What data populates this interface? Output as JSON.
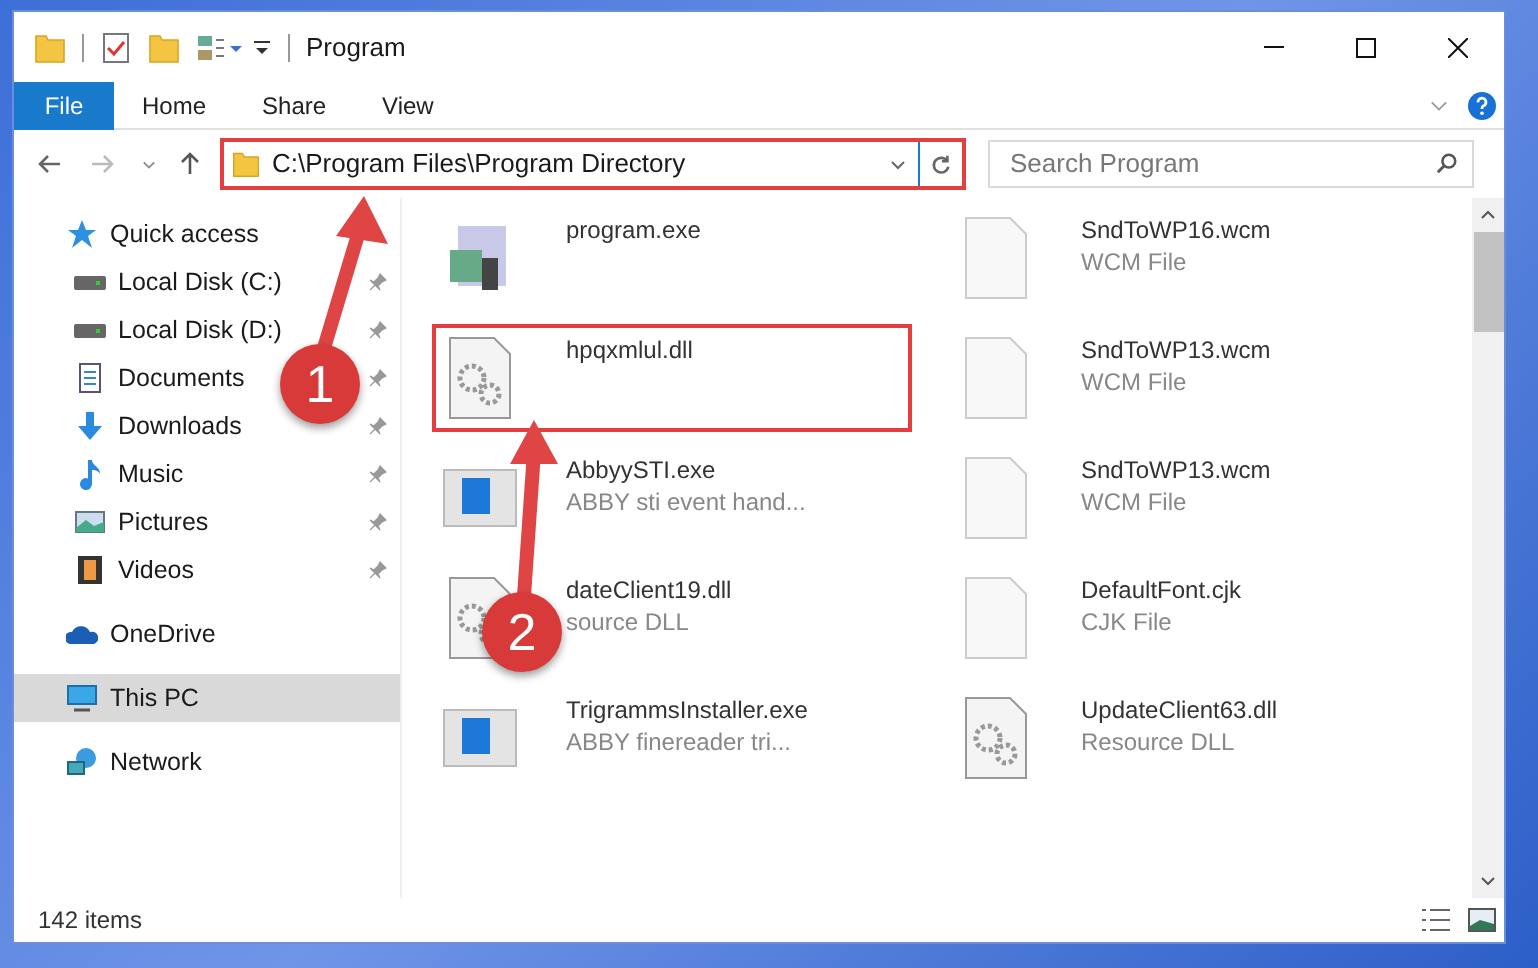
{
  "window": {
    "title": "Program"
  },
  "ribbon_tabs": [
    {
      "label": "File",
      "kind": "file",
      "selected": false
    },
    {
      "label": "Home",
      "kind": "tab",
      "selected": false
    },
    {
      "label": "Share",
      "kind": "tab",
      "selected": false
    },
    {
      "label": "View",
      "kind": "tab",
      "selected": false
    }
  ],
  "address_bar": {
    "path": "C:\\Program Files\\Program Directory",
    "highlighted": true
  },
  "search": {
    "placeholder": "Search Program"
  },
  "navigation": [
    {
      "label": "Quick access",
      "kind": "star",
      "selected": false,
      "children": [
        {
          "label": "Local Disk (C:)",
          "kind": "drive",
          "pinned": true
        },
        {
          "label": "Local Disk (D:)",
          "kind": "drive",
          "pinned": true
        },
        {
          "label": "Documents",
          "kind": "documents",
          "pinned": true
        },
        {
          "label": "Downloads",
          "kind": "downloads",
          "pinned": true
        },
        {
          "label": "Music",
          "kind": "music",
          "pinned": true
        },
        {
          "label": "Pictures",
          "kind": "pictures",
          "pinned": true
        },
        {
          "label": "Videos",
          "kind": "videos",
          "pinned": true
        }
      ]
    },
    {
      "label": "OneDrive",
      "kind": "cloud",
      "selected": false
    },
    {
      "label": "This PC",
      "kind": "pc",
      "selected": true
    },
    {
      "label": "Network",
      "kind": "network",
      "selected": false
    }
  ],
  "files": [
    {
      "name": "program.exe",
      "kind": "exe",
      "highlighted": false
    },
    {
      "name": "SndToWP16.wcm",
      "description": "WCM File",
      "kind": "blank",
      "highlighted": false
    },
    {
      "name": "hpqxmlul.dll",
      "kind": "dll",
      "highlighted": true
    },
    {
      "name": "SndToWP13.wcm",
      "description": "WCM File",
      "kind": "blank",
      "highlighted": false
    },
    {
      "name": "AbbyySTI.exe",
      "description": "ABBY sti event hand...",
      "kind": "app",
      "highlighted": false
    },
    {
      "name": "SndToWP13.wcm",
      "description": "WCM File",
      "kind": "blank",
      "highlighted": false
    },
    {
      "name": "dateClient19.dll",
      "description": "source DLL",
      "kind": "dll",
      "highlighted": false
    },
    {
      "name": "DefaultFont.cjk",
      "description": "CJK File",
      "kind": "blank",
      "highlighted": false
    },
    {
      "name": "TrigrammsInstaller.exe",
      "description": "ABBY finereader tri...",
      "kind": "app",
      "highlighted": false
    },
    {
      "name": "UpdateClient63.dll",
      "description": "Resource DLL",
      "kind": "dll",
      "highlighted": false
    }
  ],
  "annotations": [
    {
      "label": "1",
      "kind": "address"
    },
    {
      "label": "2",
      "kind": "file"
    }
  ],
  "status_bar": {
    "count": "142 items"
  }
}
